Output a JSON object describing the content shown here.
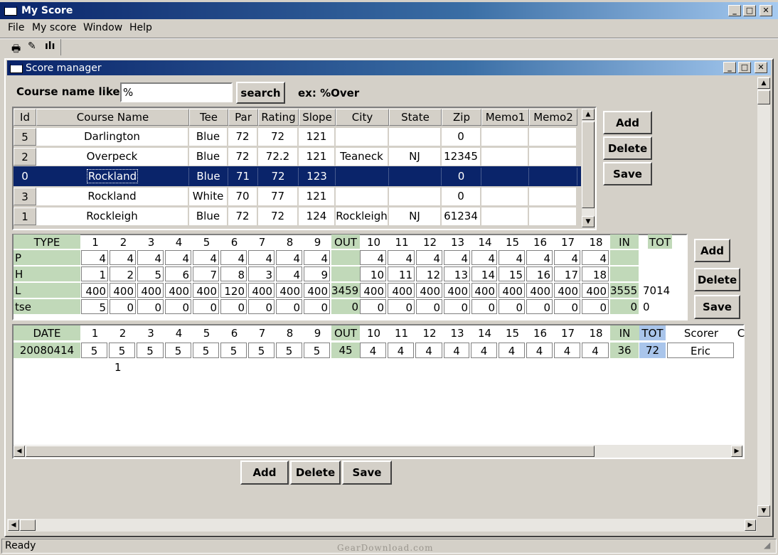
{
  "app": {
    "title": "My Score",
    "status": "Ready",
    "watermark": "GearDownload.com"
  },
  "menu": [
    "File",
    "My score",
    "Window",
    "Help"
  ],
  "child": {
    "title": "Score manager"
  },
  "search": {
    "label": "Course name like:",
    "value": "%",
    "button": "search",
    "example": "ex: %Over"
  },
  "courses": {
    "columns": [
      "Id",
      "Course Name",
      "Tee",
      "Par",
      "Rating",
      "Slope",
      "City",
      "State",
      "Zip",
      "Memo1",
      "Memo2"
    ],
    "rows": [
      [
        "5",
        "Darlington",
        "Blue",
        "72",
        "72",
        "121",
        "",
        "",
        "0",
        "",
        ""
      ],
      [
        "2",
        "Overpeck",
        "Blue",
        "72",
        "72.2",
        "121",
        "Teaneck",
        "NJ",
        "12345",
        "",
        ""
      ],
      [
        "0",
        "Rockland",
        "Blue",
        "71",
        "72",
        "123",
        "",
        "",
        "0",
        "",
        ""
      ],
      [
        "3",
        "Rockland",
        "White",
        "70",
        "77",
        "121",
        "",
        "",
        "0",
        "",
        ""
      ],
      [
        "1",
        "Rockleigh",
        "Blue",
        "72",
        "72",
        "124",
        "Rockleigh",
        "NJ",
        "61234",
        "",
        ""
      ]
    ],
    "selected_index": 2,
    "buttons": {
      "add": "Add",
      "delete": "Delete",
      "save": "Save"
    }
  },
  "holes": {
    "header": [
      "TYPE",
      "1",
      "2",
      "3",
      "4",
      "5",
      "6",
      "7",
      "8",
      "9",
      "OUT",
      "10",
      "11",
      "12",
      "13",
      "14",
      "15",
      "16",
      "17",
      "18",
      "IN",
      "TOT"
    ],
    "rows": [
      [
        "P",
        "4",
        "4",
        "4",
        "4",
        "4",
        "4",
        "4",
        "4",
        "4",
        "",
        "4",
        "4",
        "4",
        "4",
        "4",
        "4",
        "4",
        "4",
        "4",
        "",
        ""
      ],
      [
        "H",
        "1",
        "2",
        "5",
        "6",
        "7",
        "8",
        "3",
        "4",
        "9",
        "",
        "10",
        "11",
        "12",
        "13",
        "14",
        "15",
        "16",
        "17",
        "18",
        "",
        ""
      ],
      [
        "L",
        "400",
        "400",
        "400",
        "400",
        "400",
        "120",
        "400",
        "400",
        "400",
        "3459",
        "400",
        "400",
        "400",
        "400",
        "400",
        "400",
        "400",
        "400",
        "400",
        "3555",
        "7014"
      ],
      [
        "tse",
        "5",
        "0",
        "0",
        "0",
        "0",
        "0",
        "0",
        "0",
        "0",
        "0",
        "0",
        "0",
        "0",
        "0",
        "0",
        "0",
        "0",
        "0",
        "0",
        "0",
        "0"
      ]
    ],
    "buttons": {
      "add": "Add",
      "delete": "Delete",
      "save": "Save"
    }
  },
  "scores": {
    "header": [
      "DATE",
      "1",
      "2",
      "3",
      "4",
      "5",
      "6",
      "7",
      "8",
      "9",
      "OUT",
      "10",
      "11",
      "12",
      "13",
      "14",
      "15",
      "16",
      "17",
      "18",
      "IN",
      "TOT",
      "Scorer",
      "C"
    ],
    "row": [
      "20080414",
      "5",
      "5",
      "5",
      "5",
      "5",
      "5",
      "5",
      "5",
      "5",
      "45",
      "4",
      "4",
      "4",
      "4",
      "4",
      "4",
      "4",
      "4",
      "4",
      "36",
      "72",
      "Eric"
    ],
    "extra": "1",
    "buttons": {
      "add": "Add",
      "delete": "Delete",
      "save": "Save"
    }
  }
}
